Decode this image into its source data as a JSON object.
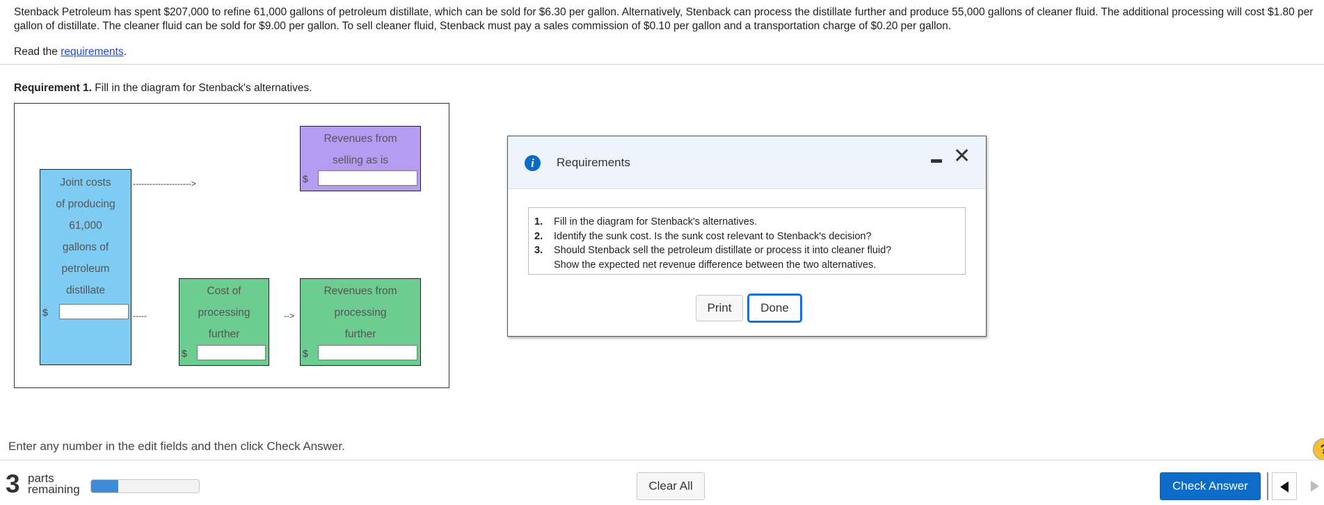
{
  "problem_text": "Stenback Petroleum has spent $207,000 to refine 61,000 gallons of petroleum distillate, which can be sold for $6.30 per gallon. Alternatively, Stenback can process the distillate further and produce 55,000 gallons of cleaner fluid. The additional processing will cost $1.80 per gallon of distillate. The cleaner fluid can be sold for $9.00 per gallon. To sell cleaner fluid, Stenback must pay a sales commission of $0.10 per gallon and a transportation charge of $0.20 per gallon.",
  "read": {
    "prefix": "Read the ",
    "link": "requirements",
    "suffix": "."
  },
  "requirement1": {
    "bold": "Requirement 1.",
    "text": " Fill in the diagram for Stenback's alternatives."
  },
  "diagram": {
    "joint_costs": [
      "Joint costs",
      "of producing",
      "61,000",
      "gallons of",
      "petroleum",
      "distillate"
    ],
    "revenues_as_is": [
      "Revenues from",
      "selling as is"
    ],
    "cost_further": [
      "Cost of",
      "processing",
      "further"
    ],
    "revenues_further": [
      "Revenues from",
      "processing",
      "further"
    ],
    "dollar": "$",
    "arrow_top": "--------------------->",
    "dash_mid": "-----",
    "arrow_mid": "-->",
    "fields": {
      "joint": "",
      "as_is": "",
      "cost": "",
      "further": ""
    }
  },
  "modal": {
    "title": "Requirements",
    "items": [
      {
        "num": "1.",
        "text": "Fill in the diagram for Stenback's alternatives."
      },
      {
        "num": "2.",
        "text": "Identify the sunk cost. Is the sunk cost relevant to Stenback's decision?"
      },
      {
        "num": "3.",
        "text": "Should Stenback sell the petroleum distillate or process it into cleaner fluid?"
      },
      {
        "num": "",
        "text": "Show the expected net revenue difference between the two alternatives."
      }
    ],
    "print_label": "Print",
    "done_label": "Done"
  },
  "footer": {
    "instruction": "Enter any number in the edit fields and then click Check Answer.",
    "parts_number": "3",
    "parts_line1": "parts",
    "parts_line2": "remaining",
    "progress_fraction": 0.25,
    "clear_label": "Clear All",
    "check_label": "Check Answer",
    "help_symbol": "?"
  },
  "colors": {
    "joint_box": "#7ecbf4",
    "sell_box": "#b59cf0",
    "process_box": "#6dcd91",
    "primary_button": "#0e6cc9",
    "progress_fill": "#3f8bd6"
  },
  "icons": [
    "info-icon",
    "minimize-icon",
    "close-icon",
    "help-icon",
    "prev-arrow-icon",
    "next-arrow-icon"
  ]
}
